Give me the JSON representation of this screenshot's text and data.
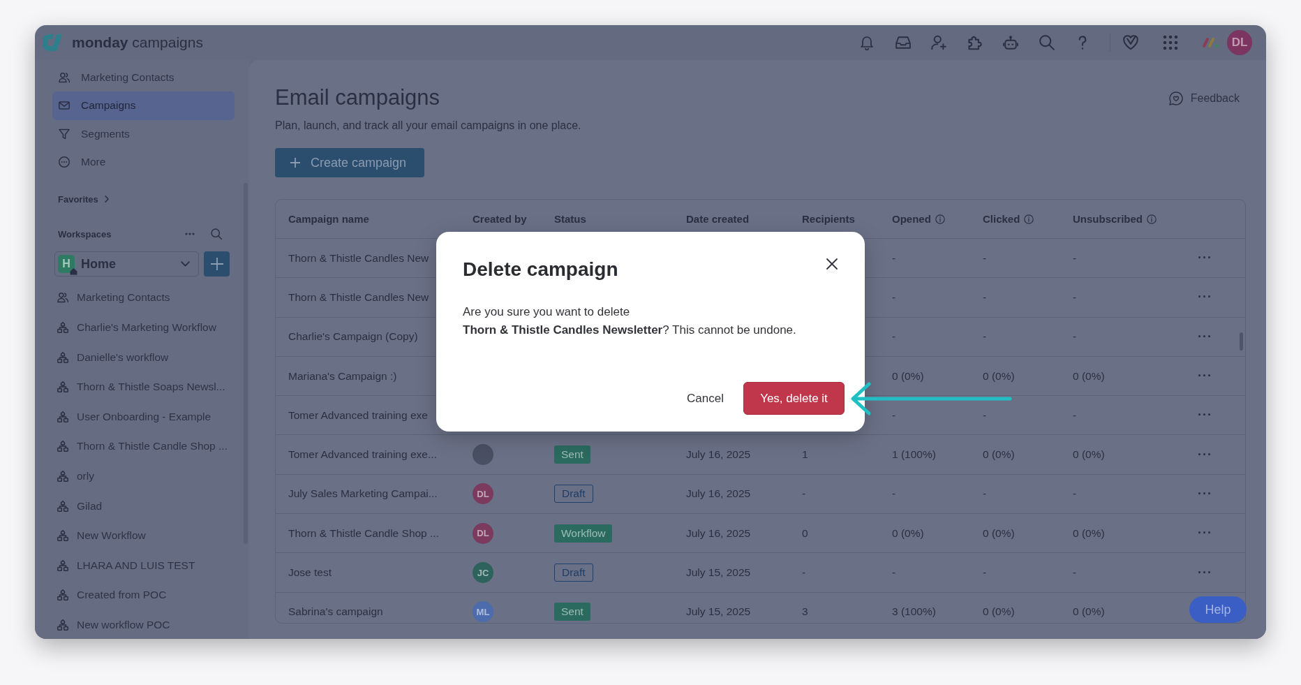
{
  "brand": "**monday** campaigns",
  "topbar": {
    "avatar": "DL"
  },
  "sidebar": {
    "nav": [
      {
        "label": "Marketing Contacts",
        "selected": false
      },
      {
        "label": "Campaigns",
        "selected": true
      },
      {
        "label": "Segments",
        "selected": false
      },
      {
        "label": "More",
        "selected": false
      }
    ],
    "favorites": "Favorites",
    "workspaces": {
      "label": "Workspaces",
      "current": {
        "badge": "H",
        "name": "Home"
      },
      "items": [
        {
          "label": "Marketing Contacts",
          "kind": "contacts"
        },
        {
          "label": "Charlie's Marketing Workflow",
          "kind": "workflow"
        },
        {
          "label": "Danielle's workflow",
          "kind": "workflow"
        },
        {
          "label": "Thorn & Thistle Soaps Newsl...",
          "kind": "workflow"
        },
        {
          "label": "User Onboarding - Example",
          "kind": "workflow"
        },
        {
          "label": "Thorn & Thistle Candle Shop ...",
          "kind": "workflow"
        },
        {
          "label": "orly",
          "kind": "workflow"
        },
        {
          "label": "Gilad",
          "kind": "workflow"
        },
        {
          "label": "New Workflow",
          "kind": "workflow"
        },
        {
          "label": "LHARA AND LUIS TEST",
          "kind": "workflow"
        },
        {
          "label": "Created from POC",
          "kind": "workflow"
        },
        {
          "label": "New workflow POC",
          "kind": "workflow"
        }
      ]
    }
  },
  "page": {
    "title": "Email campaigns",
    "subtitle": "Plan, launch, and track all your email campaigns in one place.",
    "feedback": "Feedback",
    "create_button": "Create campaign"
  },
  "table": {
    "columns": [
      {
        "label": "Campaign name",
        "info": false
      },
      {
        "label": "Created by",
        "info": false
      },
      {
        "label": "Status",
        "info": false
      },
      {
        "label": "Date created",
        "info": false
      },
      {
        "label": "Recipients",
        "info": false
      },
      {
        "label": "Opened",
        "info": true
      },
      {
        "label": "Clicked",
        "info": true
      },
      {
        "label": "Unsubscribed",
        "info": true
      }
    ],
    "rows": [
      {
        "name": "Thorn & Thistle Candles New",
        "opened": "-",
        "clicked": "-",
        "unsubscribed": "-",
        "menu": "···"
      },
      {
        "name": "Thorn & Thistle Candles New",
        "opened": "-",
        "clicked": "-",
        "unsubscribed": "-",
        "menu": "···"
      },
      {
        "name": "Charlie's Campaign (Copy)",
        "opened": "-",
        "clicked": "-",
        "unsubscribed": "-",
        "menu": "···"
      },
      {
        "name": "Mariana's Campaign :)",
        "opened": "0 (0%)",
        "clicked": "0 (0%)",
        "unsubscribed": "0 (0%)",
        "menu": "···"
      },
      {
        "name": "Tomer Advanced training exe",
        "opened": "-",
        "clicked": "-",
        "unsubscribed": "-",
        "menu": "···"
      },
      {
        "name": "Tomer Advanced training exe...",
        "created_by": {
          "kind": "photo"
        },
        "status": {
          "label": "Sent",
          "kind": "filled"
        },
        "date": "July 16, 2025",
        "recipients": "1",
        "opened": "1 (100%)",
        "clicked": "0 (0%)",
        "unsubscribed": "0 (0%)",
        "menu": "···"
      },
      {
        "name": "July Sales Marketing Campai...",
        "created_by": {
          "kind": "initials",
          "initials": "DL",
          "color": "#7b3a5e"
        },
        "status": {
          "label": "Draft",
          "kind": "outline"
        },
        "date": "July 16, 2025",
        "recipients": "-",
        "opened": "-",
        "clicked": "-",
        "unsubscribed": "-",
        "menu": "···"
      },
      {
        "name": "Thorn & Thistle Candle Shop ...",
        "created_by": {
          "kind": "initials",
          "initials": "DL",
          "color": "#7b3a5e"
        },
        "status": {
          "label": "Workflow",
          "kind": "filled"
        },
        "date": "July 16, 2025",
        "recipients": "0",
        "opened": "0 (0%)",
        "clicked": "0 (0%)",
        "unsubscribed": "0 (0%)",
        "menu": "···"
      },
      {
        "name": "Jose test",
        "created_by": {
          "kind": "initials",
          "initials": "JC",
          "color": "#2e625d"
        },
        "status": {
          "label": "Draft",
          "kind": "outline"
        },
        "date": "July 15, 2025",
        "recipients": "-",
        "opened": "-",
        "clicked": "-",
        "unsubscribed": "-",
        "menu": "···"
      },
      {
        "name": "Sabrina's campaign",
        "created_by": {
          "kind": "initials",
          "initials": "ML",
          "color": "#4d6cad"
        },
        "status": {
          "label": "Sent",
          "kind": "filled"
        },
        "date": "July 15, 2025",
        "recipients": "3",
        "opened": "3 (100%)",
        "clicked": "0 (0%)",
        "unsubscribed": "0 (0%)"
      }
    ]
  },
  "dialog": {
    "title": "Delete campaign",
    "message": "Are you sure you want to delete\n**Thorn & Thistle Candles Newsletter**? This cannot be undone.",
    "buttons": [
      {
        "label": "Cancel",
        "kind": "secondary",
        "pointed": false
      },
      {
        "label": "Yes, delete it",
        "kind": "danger",
        "pointed": true
      }
    ]
  },
  "help_button": "Help"
}
